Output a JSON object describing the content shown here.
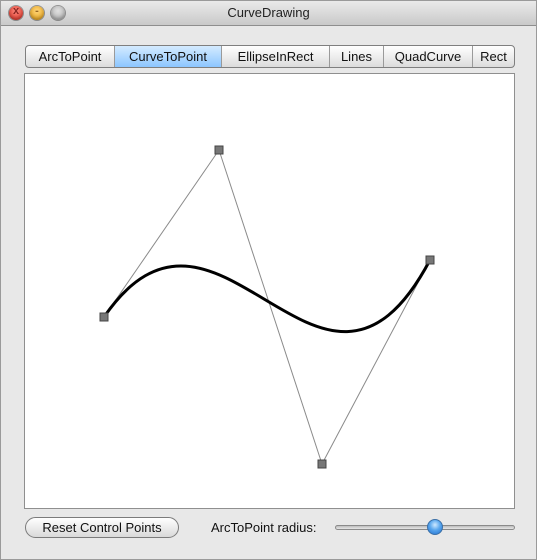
{
  "window": {
    "title": "CurveDrawing",
    "controls": {
      "close": "x",
      "minimize": "-"
    }
  },
  "tabs": [
    {
      "label": "ArcToPoint",
      "active": false
    },
    {
      "label": "CurveToPoint",
      "active": true
    },
    {
      "label": "EllipseInRect",
      "active": false
    },
    {
      "label": "Lines",
      "active": false
    },
    {
      "label": "QuadCurve",
      "active": false
    },
    {
      "label": "Rect",
      "active": false
    }
  ],
  "footer": {
    "reset_label": "Reset Control Points",
    "radius_label": "ArcToPoint radius:",
    "radius_slider_fraction": 0.56
  },
  "colors": {
    "active_tab": "#8cc6ff",
    "curve": "#000000",
    "control_line": "#808080",
    "control_point": "#7a7a7a"
  }
}
